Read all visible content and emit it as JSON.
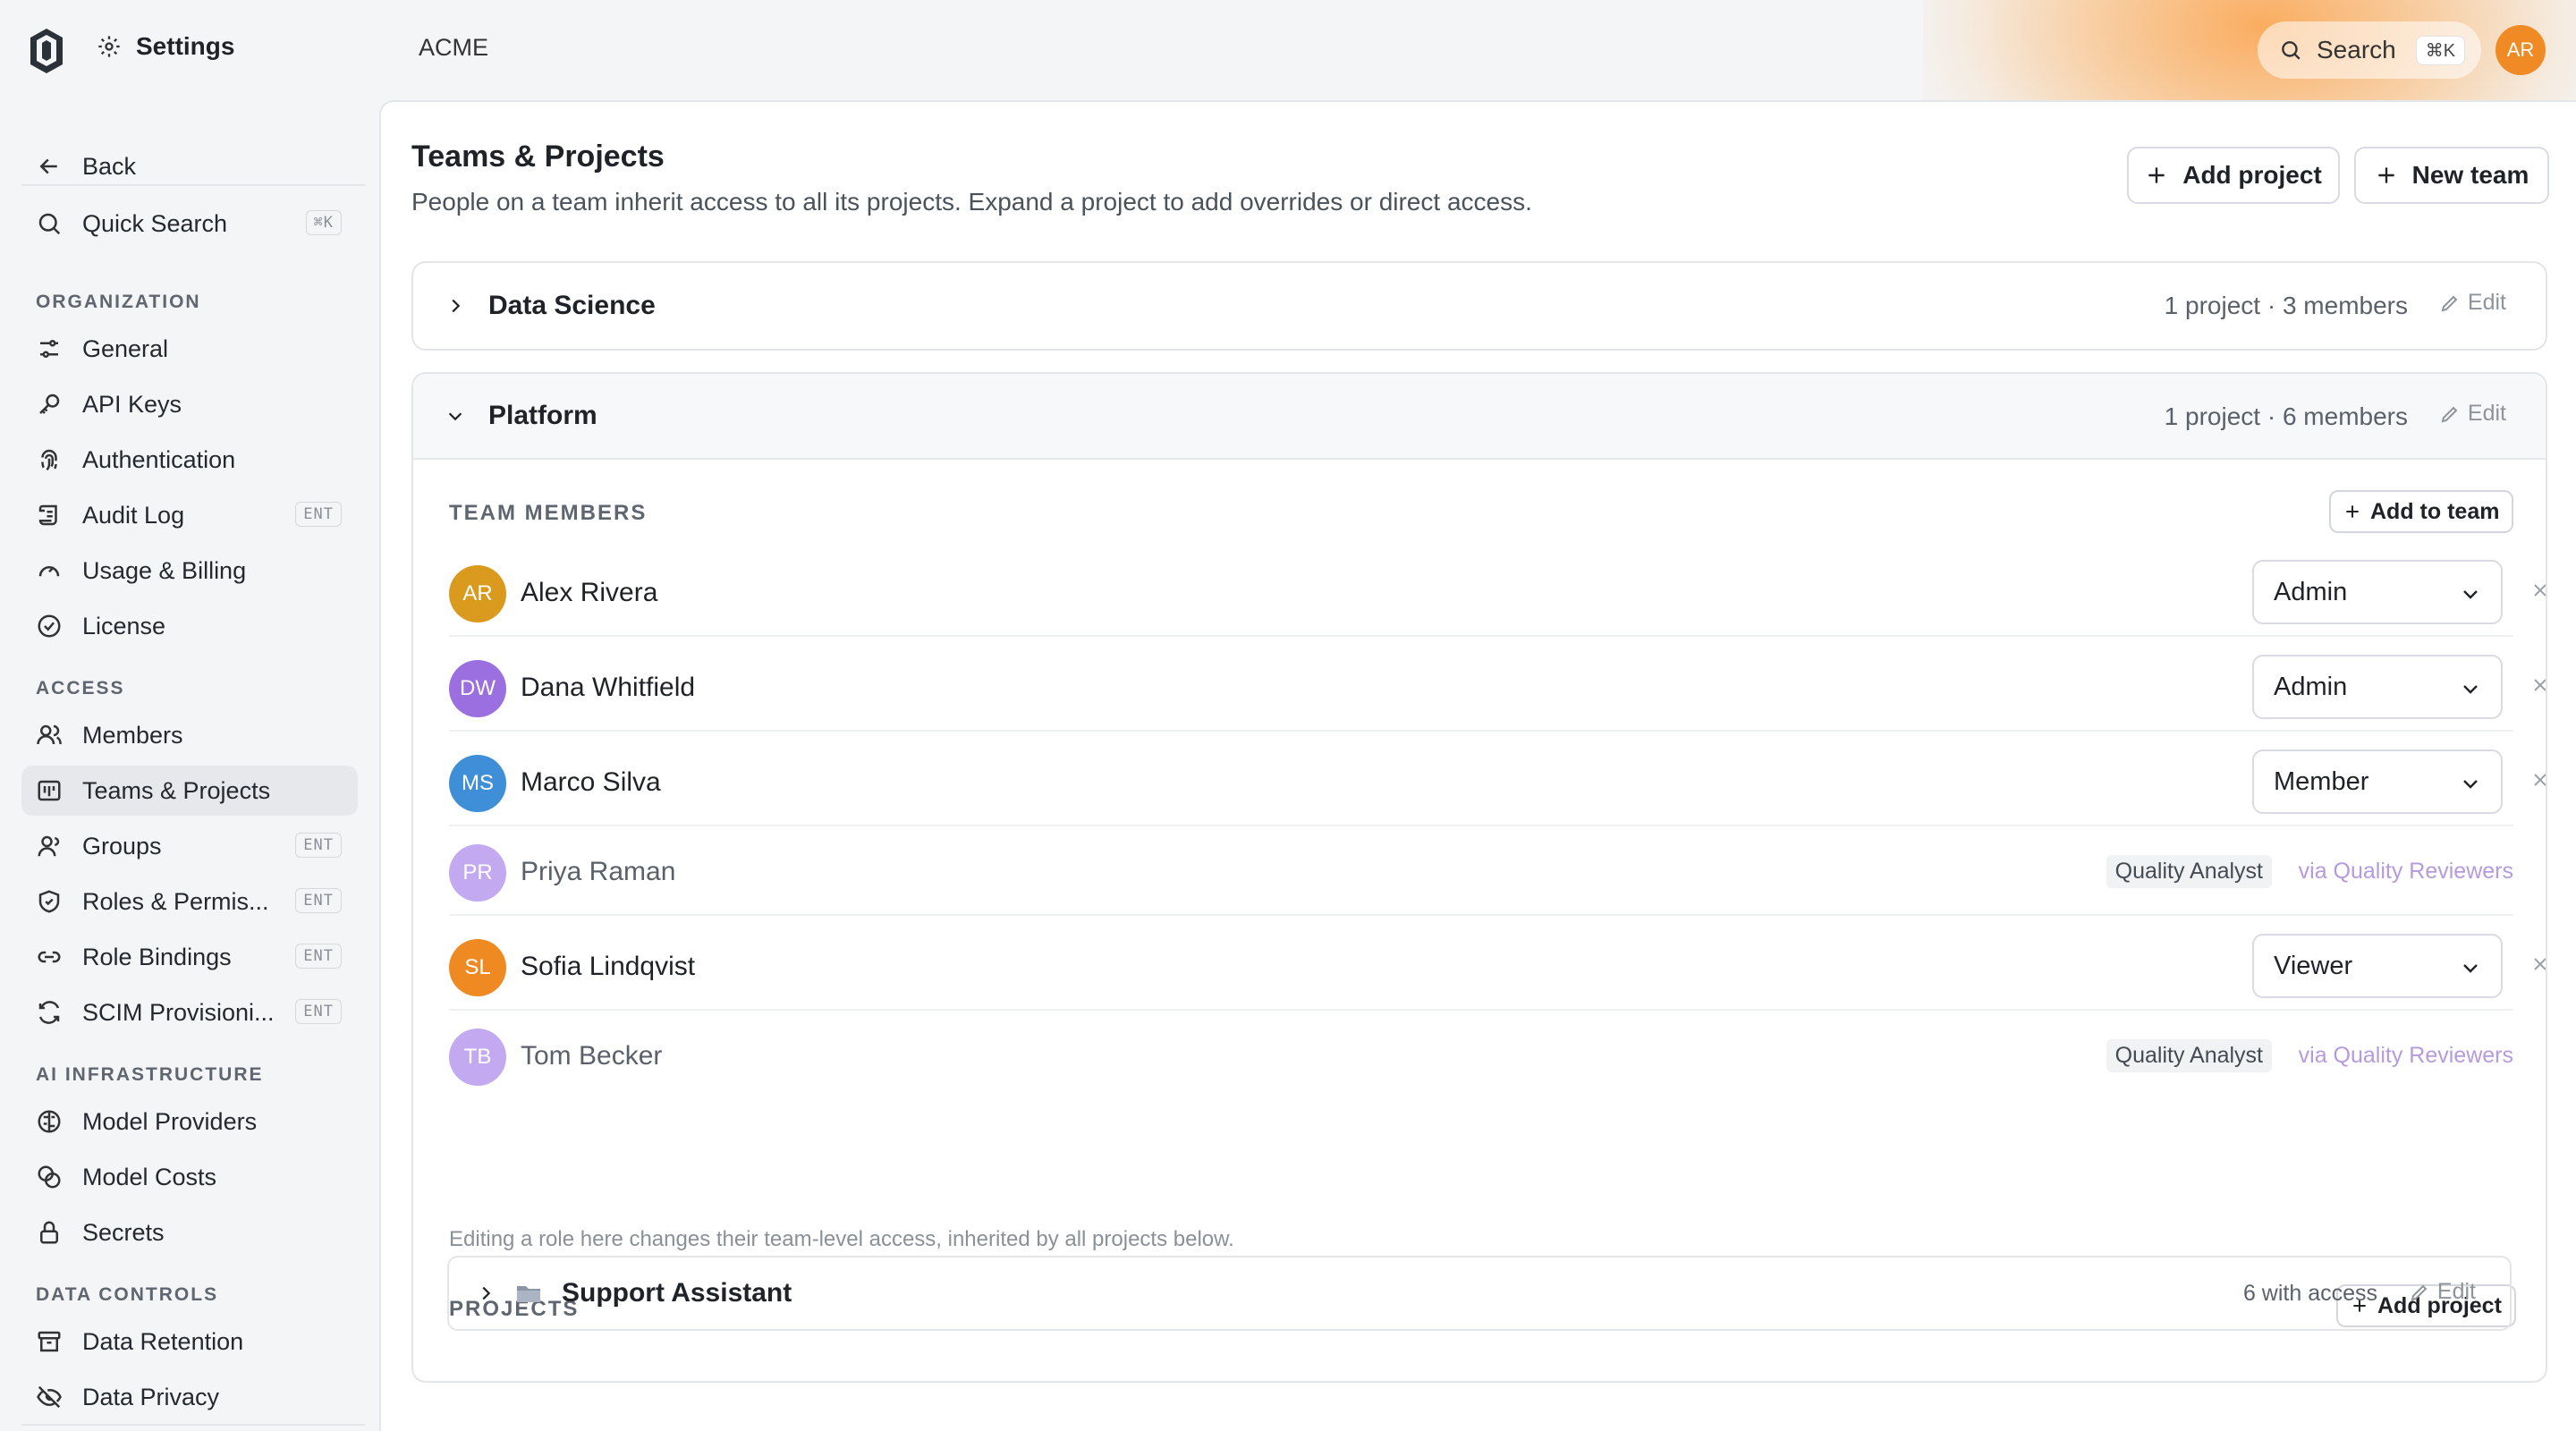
{
  "header": {
    "settings_title": "Settings",
    "org_name": "ACME",
    "search_label": "Search",
    "search_shortcut": "⌘K",
    "user_initials": "AR",
    "accent_color": "#f08a24"
  },
  "sidebar": {
    "back_label": "Back",
    "quick_search_label": "Quick Search",
    "quick_search_shortcut": "⌘K",
    "sections": {
      "organization": "ORGANIZATION",
      "access": "ACCESS",
      "ai_infrastructure": "AI INFRASTRUCTURE",
      "data_controls": "DATA CONTROLS"
    },
    "items": [
      {
        "label": "General",
        "icon": "sliders-icon"
      },
      {
        "label": "API Keys",
        "icon": "key-icon"
      },
      {
        "label": "Authentication",
        "icon": "fingerprint-icon"
      },
      {
        "label": "Audit Log",
        "icon": "scroll-icon",
        "badge": "ENT"
      },
      {
        "label": "Usage & Billing",
        "icon": "gauge-icon"
      },
      {
        "label": "License",
        "icon": "check-circle-icon"
      },
      {
        "label": "Members",
        "icon": "users-icon"
      },
      {
        "label": "Teams & Projects",
        "icon": "kanban-icon",
        "active": true
      },
      {
        "label": "Groups",
        "icon": "users-group-icon",
        "badge": "ENT"
      },
      {
        "label": "Roles & Permis...",
        "icon": "shield-icon",
        "badge": "ENT"
      },
      {
        "label": "Role Bindings",
        "icon": "link-icon",
        "badge": "ENT"
      },
      {
        "label": "SCIM Provisioni...",
        "icon": "refresh-icon",
        "badge": "ENT"
      },
      {
        "label": "Model Providers",
        "icon": "brain-icon"
      },
      {
        "label": "Model Costs",
        "icon": "coins-icon"
      },
      {
        "label": "Secrets",
        "icon": "lock-icon"
      },
      {
        "label": "Data Retention",
        "icon": "archive-icon"
      },
      {
        "label": "Data Privacy",
        "icon": "eye-off-icon"
      }
    ]
  },
  "main": {
    "title": "Teams & Projects",
    "subtitle": "People on a team inherit access to all its projects. Expand a project to add overrides or direct access.",
    "add_project_label": "Add project",
    "new_team_label": "New team",
    "edit_label": "Edit",
    "teams": [
      {
        "name": "Data Science",
        "meta": "1 project · 3 members",
        "expanded": false
      },
      {
        "name": "Platform",
        "meta": "1 project · 6 members",
        "expanded": true
      }
    ],
    "team_members_label": "TEAM MEMBERS",
    "add_to_team_label": "Add to team",
    "members": [
      {
        "initials": "AR",
        "name": "Alex Rivera",
        "role": "Admin",
        "color": "#d99a1e"
      },
      {
        "initials": "DW",
        "name": "Dana Whitfield",
        "role": "Admin",
        "color": "#9b6fe0"
      },
      {
        "initials": "MS",
        "name": "Marco Silva",
        "role": "Member",
        "color": "#3f8fd8"
      },
      {
        "initials": "PR",
        "name": "Priya Raman",
        "role_badge": "Quality Analyst",
        "via": "via Quality Reviewers",
        "color": "#c3aaf0"
      },
      {
        "initials": "SL",
        "name": "Sofia Lindqvist",
        "role": "Viewer",
        "color": "#ef8a22"
      },
      {
        "initials": "TB",
        "name": "Tom Becker",
        "role_badge": "Quality Analyst",
        "via": "via Quality Reviewers",
        "color": "#c3aaf0"
      }
    ],
    "role_note": "Editing a role here changes their team-level access, inherited by all projects below.",
    "projects_label": "PROJECTS",
    "add_project_small_label": "Add project",
    "projects": [
      {
        "name": "Support Assistant",
        "meta": "6 with access",
        "icon": "folder-icon"
      }
    ]
  }
}
